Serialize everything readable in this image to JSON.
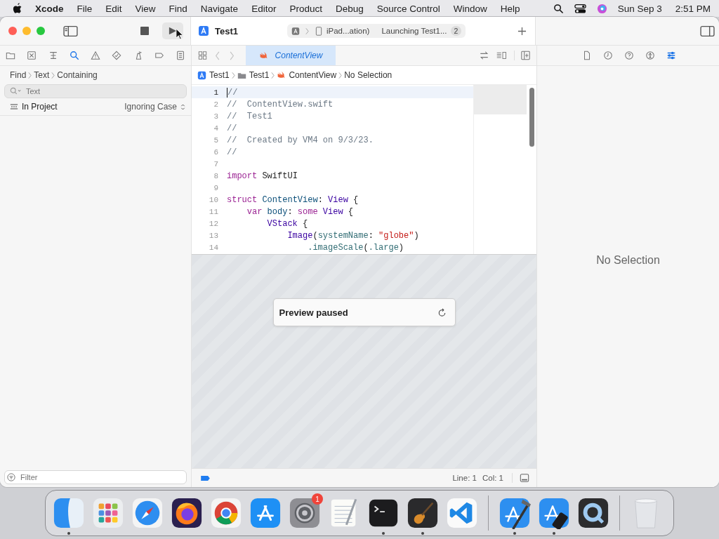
{
  "menu_bar": {
    "app": "Xcode",
    "menus": [
      "File",
      "Edit",
      "View",
      "Find",
      "Navigate",
      "Editor",
      "Product",
      "Debug",
      "Source Control",
      "Window",
      "Help"
    ],
    "date": "Sun Sep 3",
    "time": "2:51 PM"
  },
  "toolbar": {
    "project": "Test1",
    "destination": "iPad...ation)",
    "activity": "Launching Test1...",
    "activity_count": "2"
  },
  "navigator": {
    "tabs": [
      {
        "kind": "folder",
        "selected": false
      },
      {
        "kind": "xbox",
        "selected": false
      },
      {
        "kind": "hierarchy",
        "selected": false
      },
      {
        "kind": "search",
        "selected": true
      },
      {
        "kind": "warning",
        "selected": false
      },
      {
        "kind": "diamond",
        "selected": false
      },
      {
        "kind": "debug",
        "selected": false
      },
      {
        "kind": "breakpoint",
        "selected": false
      },
      {
        "kind": "report",
        "selected": false
      }
    ],
    "path": [
      "Find",
      "Text",
      "Containing"
    ],
    "search": {
      "placeholder": "Text"
    },
    "scope": "In Project",
    "matching": "Ignoring Case",
    "filter": {
      "placeholder": "Filter"
    }
  },
  "editor": {
    "tabs": [
      {
        "label": "ContentView",
        "selected": true
      }
    ],
    "jump_bar": [
      {
        "kind": "project",
        "label": "Test1"
      },
      {
        "kind": "folder",
        "label": "Test1"
      },
      {
        "kind": "swift",
        "label": "ContentView"
      },
      {
        "kind": "none",
        "label": "No Selection"
      }
    ],
    "lines": [
      {
        "number": "1",
        "current": true,
        "tokens": [
          {
            "kind": "comment",
            "text": "//"
          }
        ]
      },
      {
        "number": "2",
        "current": false,
        "tokens": [
          {
            "kind": "comment",
            "text": "//  ContentView.swift"
          }
        ]
      },
      {
        "number": "3",
        "current": false,
        "tokens": [
          {
            "kind": "comment",
            "text": "//  Test1"
          }
        ]
      },
      {
        "number": "4",
        "current": false,
        "tokens": [
          {
            "kind": "comment",
            "text": "//"
          }
        ]
      },
      {
        "number": "5",
        "current": false,
        "tokens": [
          {
            "kind": "comment",
            "text": "//  Created by VM4 on 9/3/23."
          }
        ]
      },
      {
        "number": "6",
        "current": false,
        "tokens": [
          {
            "kind": "comment",
            "text": "//"
          }
        ]
      },
      {
        "number": "7",
        "current": false
      },
      {
        "number": "8",
        "current": false,
        "tokens": [
          {
            "kind": "keyword",
            "text": "import"
          },
          {
            "kind": "plain",
            "text": " SwiftUI"
          }
        ]
      },
      {
        "number": "9",
        "current": false
      },
      {
        "number": "10",
        "current": false,
        "tokens": [
          {
            "kind": "keyword",
            "text": "struct"
          },
          {
            "kind": "declaration",
            "text": " ContentView"
          },
          {
            "kind": "plain",
            "text": ": "
          },
          {
            "kind": "type",
            "text": "View"
          },
          {
            "kind": "plain",
            "text": " {"
          }
        ]
      },
      {
        "number": "11",
        "current": false,
        "tokens": [
          {
            "kind": "keyword",
            "text": "    var"
          },
          {
            "kind": "declaration",
            "text": " body"
          },
          {
            "kind": "plain",
            "text": ": "
          },
          {
            "kind": "keyword",
            "text": "some"
          },
          {
            "kind": "type",
            "text": " View"
          },
          {
            "kind": "plain",
            "text": " {"
          }
        ]
      },
      {
        "number": "12",
        "current": false,
        "tokens": [
          {
            "kind": "type",
            "text": "        VStack"
          },
          {
            "kind": "plain",
            "text": " {"
          }
        ]
      },
      {
        "number": "13",
        "current": false,
        "tokens": [
          {
            "kind": "type",
            "text": "            Image"
          },
          {
            "kind": "plain",
            "text": "("
          },
          {
            "kind": "function",
            "text": "systemName"
          },
          {
            "kind": "plain",
            "text": ": "
          },
          {
            "kind": "string",
            "text": "\"globe\""
          },
          {
            "kind": "plain",
            "text": ")"
          }
        ]
      },
      {
        "number": "14",
        "current": false,
        "tokens": [
          {
            "kind": "function",
            "text": "                .imageScale"
          },
          {
            "kind": "plain",
            "text": "("
          },
          {
            "kind": "function",
            "text": ".large"
          },
          {
            "kind": "plain",
            "text": ")"
          }
        ]
      }
    ],
    "preview": {
      "message": "Preview paused"
    },
    "status": {
      "line": "Line: 1",
      "column": "Col: 1"
    }
  },
  "inspector": {
    "tabs": [
      {
        "kind": "file",
        "selected": false
      },
      {
        "kind": "clock",
        "selected": false
      },
      {
        "kind": "help",
        "selected": false
      },
      {
        "kind": "accessibility",
        "selected": false
      },
      {
        "kind": "attributes",
        "selected": true
      }
    ],
    "message": "No Selection"
  },
  "dock": {
    "groups": [
      [
        {
          "kind": "finder",
          "running": true
        },
        {
          "kind": "launchpad",
          "running": false
        },
        {
          "kind": "safari",
          "running": false
        },
        {
          "kind": "firefox",
          "running": false
        },
        {
          "kind": "chrome",
          "running": false
        },
        {
          "kind": "appstore",
          "running": false
        },
        {
          "kind": "settings",
          "running": false,
          "badge": "1"
        },
        {
          "kind": "textedit",
          "running": false
        },
        {
          "kind": "terminal",
          "running": true
        },
        {
          "kind": "garageband",
          "running": true
        },
        {
          "kind": "vscode",
          "running": false
        }
      ],
      [
        {
          "kind": "xcode",
          "running": true
        },
        {
          "kind": "simulator",
          "running": true
        },
        {
          "kind": "quicktime",
          "running": false
        }
      ],
      [
        {
          "kind": "trash",
          "running": false
        }
      ]
    ]
  }
}
